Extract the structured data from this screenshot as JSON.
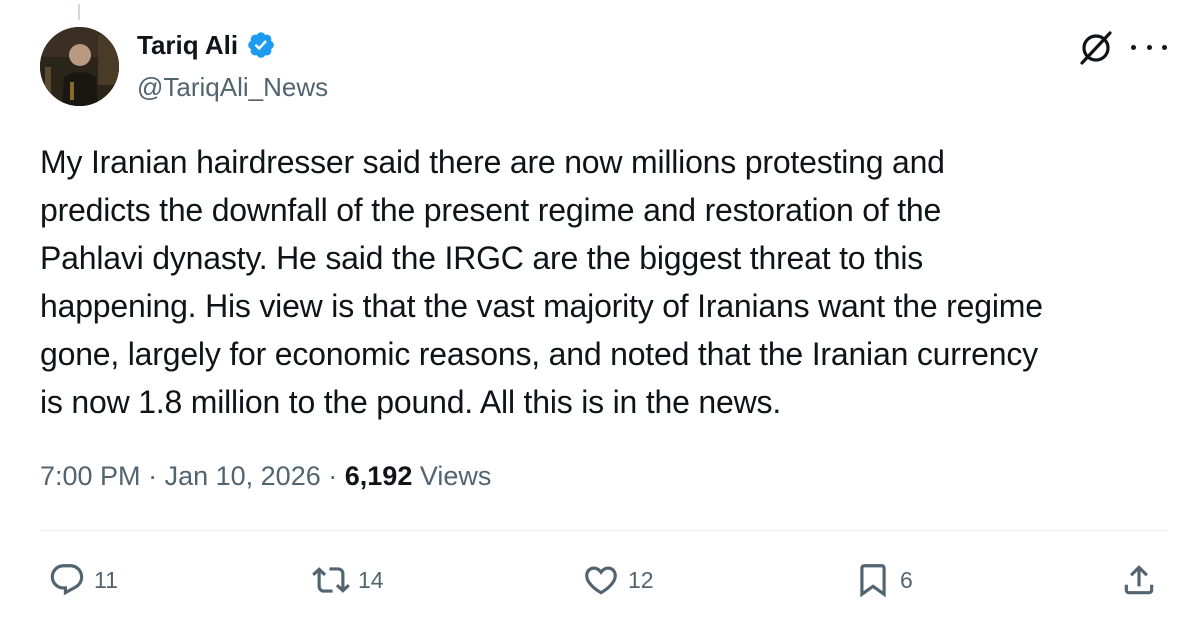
{
  "tweet": {
    "author": {
      "display_name": "Tariq Ali",
      "handle": "@TariqAli_News",
      "verified": true
    },
    "text": "My Iranian hairdresser said there are now millions protesting and\npredicts the downfall of the present regime and restoration of the\nPahlavi dynasty. He said the IRGC are the biggest threat to this\nhappening. His view is that the vast majority of Iranians want the regime\ngone, largely for economic reasons,  and noted that the Iranian currency\nis now 1.8 million to the pound. All this is in the news.",
    "time": "7:00 PM",
    "separator": "·",
    "date": "Jan 10, 2026",
    "views_count": "6,192",
    "views_label": "Views"
  },
  "actions": {
    "reply_count": "11",
    "repost_count": "14",
    "like_count": "12",
    "bookmark_count": "6"
  },
  "icons": {
    "verified": "verified-badge-icon",
    "grok": "grok-icon",
    "more": "more-icon",
    "reply": "reply-icon",
    "repost": "repost-icon",
    "like": "heart-icon",
    "bookmark": "bookmark-icon",
    "share": "share-icon"
  },
  "colors": {
    "accent": "#1d9bf0",
    "text_primary": "#0f1419",
    "text_secondary": "#536471",
    "divider": "#eff3f4"
  }
}
